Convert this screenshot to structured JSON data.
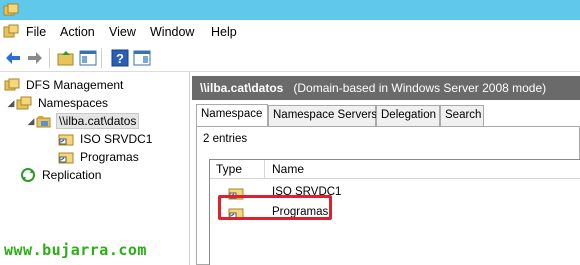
{
  "menu": {
    "items": [
      "File",
      "Action",
      "View",
      "Window",
      "Help"
    ]
  },
  "tree": {
    "root": "DFS Management",
    "namespaces": "Namespaces",
    "namespace": "\\\\ilba.cat\\datos",
    "folders": [
      "ISO SRVDC1",
      "Programas"
    ],
    "replication": "Replication"
  },
  "header": {
    "path": "\\\\ilba.cat\\datos",
    "mode": "(Domain-based in Windows Server 2008 mode)"
  },
  "tabs": [
    "Namespace",
    "Namespace Servers",
    "Delegation",
    "Search"
  ],
  "active_tab": "Namespace",
  "entries_count": "2 entries",
  "list": {
    "columns": [
      "Type",
      "Name"
    ],
    "rows": [
      {
        "name": "ISO SRVDC1",
        "icon": "folder-target-icon"
      },
      {
        "name": "Programas",
        "icon": "folder-target-icon"
      }
    ]
  },
  "watermark": "www.bujarra.com",
  "colors": {
    "titlebar": "#5fc8eb",
    "highlight": "#e0202e",
    "watermark": "#29b014",
    "header": "#6a6a6a"
  }
}
